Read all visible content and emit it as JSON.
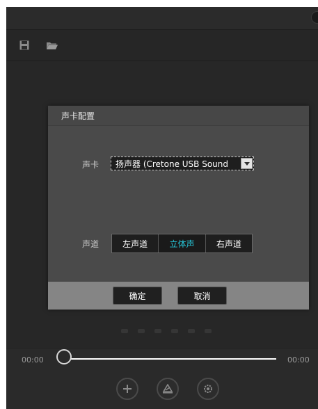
{
  "dialog": {
    "title": "声卡配置",
    "sound_card": {
      "label": "声卡",
      "selected_value": "扬声器 (Cretone USB Sound"
    },
    "channel": {
      "label": "声道",
      "options": [
        "左声道",
        "立体声",
        "右声道"
      ],
      "selected": "立体声"
    },
    "ok_label": "确定",
    "cancel_label": "取消"
  },
  "player": {
    "time_left": "00:00",
    "time_right": "00:00",
    "progress": 0
  },
  "icons": {
    "toolbar": [
      "save-icon",
      "folder-icon"
    ],
    "controls": [
      "add-icon",
      "triangle-icon",
      "settings-icon"
    ]
  },
  "colors": {
    "accent": "#26c6d8",
    "background": "#272727",
    "dialog": "#4a4a4a",
    "dialog_footer": "#858585"
  }
}
